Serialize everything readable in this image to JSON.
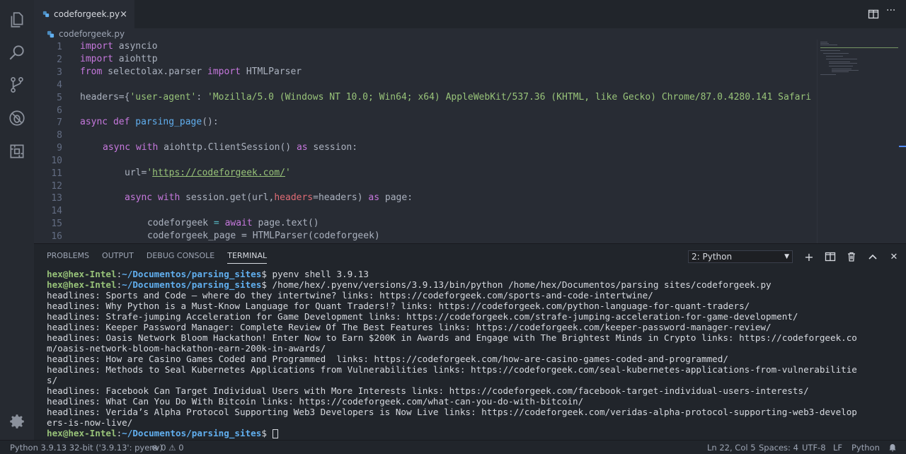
{
  "tab": {
    "filename": "codeforgeek.py",
    "close": "×"
  },
  "breadcrumb": {
    "file": "codeforgeek.py"
  },
  "editor": {
    "lines": [
      {
        "n": "1"
      },
      {
        "n": "2"
      },
      {
        "n": "3"
      },
      {
        "n": "4"
      },
      {
        "n": "5"
      },
      {
        "n": "6"
      },
      {
        "n": "7"
      },
      {
        "n": "8"
      },
      {
        "n": "9"
      },
      {
        "n": "10"
      },
      {
        "n": "11"
      },
      {
        "n": "12"
      },
      {
        "n": "13"
      },
      {
        "n": "14"
      },
      {
        "n": "15"
      },
      {
        "n": "16"
      }
    ],
    "code": {
      "l1_kw": "import",
      "l1_rest": " asyncio",
      "l2_kw": "import",
      "l2_rest": " aiohttp",
      "l3_kw1": "from",
      "l3_mid": " selectolax.parser ",
      "l3_kw2": "import",
      "l3_rest": " HTMLParser",
      "l5_a": "headers={",
      "l5_s1": "'user-agent'",
      "l5_b": ": ",
      "l5_s2": "'Mozilla/5.0 (Windows NT 10.0; Win64; x64) AppleWebKit/537.36 (KHTML, like Gecko) Chrome/87.0.4280.141 Safari",
      "l7_kw1": "async",
      "l7_kw2": " def",
      "l7_fn": " parsing_page",
      "l7_rest": "():",
      "l9_kw1": "async",
      "l9_kw2": " with",
      "l9_rest": " aiohttp.ClientSession() ",
      "l9_kw3": "as",
      "l9_end": " session:",
      "l11_a": "url=",
      "l11_q1": "'",
      "l11_url": "https://codeforgeek.com/",
      "l11_q2": "'",
      "l13_kw1": "async",
      "l13_kw2": " with",
      "l13_a": " session.get(url,",
      "l13_param": "headers",
      "l13_b": "=headers) ",
      "l13_kw3": "as",
      "l13_c": " page:",
      "l15_a": "codeforgeek ",
      "l15_op": "=",
      "l15_kw": " await",
      "l15_b": " page.text()",
      "l16_a": "codeforgeek_page = HTMLParser(codeforgeek)"
    }
  },
  "panel": {
    "tabs": [
      "PROBLEMS",
      "OUTPUT",
      "DEBUG CONSOLE",
      "TERMINAL"
    ],
    "active_tab": "TERMINAL",
    "terminal_select": "2: Python",
    "buttons": {
      "add": "+",
      "close": "✕"
    }
  },
  "terminal": {
    "user": "hex@hex-Intel",
    "sep": ":",
    "path": "~/Documentos/parsing_sites",
    "dollar": "$",
    "cmd1": " pyenv shell 3.9.13",
    "cmd2": " /home/hex/.pyenv/versions/3.9.13/bin/python /home/hex/Documentos/parsing sites/codeforgeek.py",
    "output": [
      "headlines: Sports and Code – where do they intertwine? links: https://codeforgeek.com/sports-and-code-intertwine/",
      "headlines: Why Python is a Must-Know Language for Quant Traders!? links: https://codeforgeek.com/python-language-for-quant-traders/",
      "headlines: Strafe-jumping Acceleration for Game Development links: https://codeforgeek.com/strafe-jumping-acceleration-for-game-development/",
      "headlines: Keeper Password Manager: Complete Review Of The Best Features links: https://codeforgeek.com/keeper-password-manager-review/",
      "headlines: Oasis Network Bloom Hackathon! Enter Now to Earn $200K in Awards and Engage with The Brightest Minds in Crypto links: https://codeforgeek.co",
      "m/oasis-network-bloom-hackathon-earn-200k-in-awards/",
      "headlines: How are Casino Games Coded and Programmed  links: https://codeforgeek.com/how-are-casino-games-coded-and-programmed/",
      "headlines: Methods to Seal Kubernetes Applications from Vulnerabilities links: https://codeforgeek.com/seal-kubernetes-applications-from-vulnerabilitie",
      "s/",
      "headlines: Facebook Can Target Individual Users with More Interests links: https://codeforgeek.com/facebook-target-individual-users-interests/",
      "headlines: What Can You Do With Bitcoin links: https://codeforgeek.com/what-can-you-do-with-bitcoin/",
      "headlines: Verida’s Alpha Protocol Supporting Web3 Developers is Now Live links: https://codeforgeek.com/veridas-alpha-protocol-supporting-web3-develop",
      "ers-is-now-live/"
    ]
  },
  "statusbar": {
    "interpreter": "Python 3.9.13 32-bit ('3.9.13': pyenv)",
    "errors": "0",
    "warnings": "0",
    "position": "Ln 22, Col 5",
    "spaces": "Spaces: 4",
    "encoding": "UTF-8",
    "eol": "LF",
    "language": "Python"
  },
  "colors": {
    "keyword": "#c678dd",
    "string": "#98c379",
    "function": "#61afef",
    "prompt_user": "#98c379",
    "prompt_path": "#61afef"
  },
  "icons": [
    "files-icon",
    "search-icon",
    "source-control-icon",
    "debug-icon",
    "extensions-icon",
    "settings-gear-icon",
    "python-file-icon",
    "split-editor-icon",
    "trash-icon",
    "maximize-panel-icon",
    "bell-icon"
  ]
}
